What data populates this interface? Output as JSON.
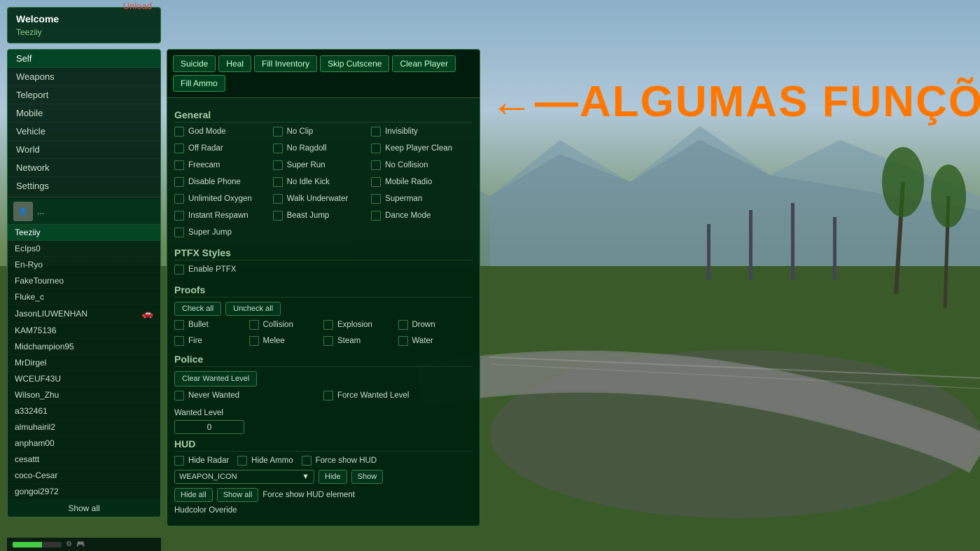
{
  "welcome": {
    "title": "Welcome",
    "username": "Teeziiy",
    "unload_label": "Unload"
  },
  "sidebar": {
    "nav_items": [
      {
        "label": "Self",
        "active": true
      },
      {
        "label": "Weapons",
        "active": false
      },
      {
        "label": "Teleport",
        "active": false
      },
      {
        "label": "Mobile",
        "active": false
      },
      {
        "label": "Vehicle",
        "active": false
      },
      {
        "label": "World",
        "active": false
      },
      {
        "label": "Network",
        "active": false
      },
      {
        "label": "Settings",
        "active": false
      }
    ],
    "users": [
      {
        "name": "Teeziiy",
        "active": true,
        "has_vehicle": false
      },
      {
        "name": "EcIps0",
        "active": false,
        "has_vehicle": false
      },
      {
        "name": "En-Ryo",
        "active": false,
        "has_vehicle": false
      },
      {
        "name": "FakeTourneo",
        "active": false,
        "has_vehicle": false
      },
      {
        "name": "Fluke_c",
        "active": false,
        "has_vehicle": false
      },
      {
        "name": "JasonLIUWENHAN",
        "active": false,
        "has_vehicle": true
      },
      {
        "name": "KAM75136",
        "active": false,
        "has_vehicle": false
      },
      {
        "name": "Midchampion95",
        "active": false,
        "has_vehicle": false
      },
      {
        "name": "MrDirgel",
        "active": false,
        "has_vehicle": false
      },
      {
        "name": "WCEUF43U",
        "active": false,
        "has_vehicle": false
      },
      {
        "name": "Wilson_Zhu",
        "active": false,
        "has_vehicle": false
      },
      {
        "name": "a332461",
        "active": false,
        "has_vehicle": false
      },
      {
        "name": "almuhairil2",
        "active": false,
        "has_vehicle": false
      },
      {
        "name": "anpham00",
        "active": false,
        "has_vehicle": false
      },
      {
        "name": "cesattt",
        "active": false,
        "has_vehicle": false
      },
      {
        "name": "coco-Cesar",
        "active": false,
        "has_vehicle": false
      },
      {
        "name": "gongoi2972",
        "active": false,
        "has_vehicle": false
      }
    ],
    "show_all_label": "Show all"
  },
  "top_buttons": [
    {
      "label": "Suicide",
      "key": "suicide"
    },
    {
      "label": "Heal",
      "key": "heal"
    },
    {
      "label": "Fill Inventory",
      "key": "fill_inventory"
    },
    {
      "label": "Skip Cutscene",
      "key": "skip_cutscene"
    },
    {
      "label": "Clean Player",
      "key": "clean_player"
    },
    {
      "label": "Fill Ammo",
      "key": "fill_ammo"
    }
  ],
  "general": {
    "title": "General",
    "toggles": [
      {
        "label": "God Mode",
        "checked": false
      },
      {
        "label": "No Clip",
        "checked": false
      },
      {
        "label": "Invisiblity",
        "checked": false
      },
      {
        "label": "Off Radar",
        "checked": false
      },
      {
        "label": "No Ragdoll",
        "checked": false
      },
      {
        "label": "Keep Player Clean",
        "checked": false
      },
      {
        "label": "Freecam",
        "checked": false
      },
      {
        "label": "Super Run",
        "checked": false
      },
      {
        "label": "No Collision",
        "checked": false
      },
      {
        "label": "Disable Phone",
        "checked": false
      },
      {
        "label": "No Idle Kick",
        "checked": false
      },
      {
        "label": "Mobile Radio",
        "checked": false
      },
      {
        "label": "Unlimited Oxygen",
        "checked": false
      },
      {
        "label": "Walk Underwater",
        "checked": false
      },
      {
        "label": "Superman",
        "checked": false
      },
      {
        "label": "Instant Respawn",
        "checked": false
      },
      {
        "label": "Beast Jump",
        "checked": false
      },
      {
        "label": "Dance Mode",
        "checked": false
      },
      {
        "label": "Super Jump",
        "checked": false
      }
    ]
  },
  "ptfx": {
    "title": "PTFX Styles",
    "toggles": [
      {
        "label": "Enable PTFX",
        "checked": false
      }
    ]
  },
  "proofs": {
    "title": "Proofs",
    "check_all_label": "Check all",
    "uncheck_all_label": "Uncheck all",
    "items": [
      {
        "label": "Bullet",
        "checked": false
      },
      {
        "label": "Collision",
        "checked": false
      },
      {
        "label": "Explosion",
        "checked": false
      },
      {
        "label": "Drown",
        "checked": false
      },
      {
        "label": "Fire",
        "checked": false
      },
      {
        "label": "Melee",
        "checked": false
      },
      {
        "label": "Steam",
        "checked": false
      },
      {
        "label": "Water",
        "checked": false
      }
    ]
  },
  "police": {
    "title": "Police",
    "clear_wanted_label": "Clear Wanted Level",
    "toggles": [
      {
        "label": "Never Wanted",
        "checked": false
      },
      {
        "label": "Force Wanted Level",
        "checked": false
      }
    ],
    "wanted_level_label": "Wanted Level",
    "wanted_value": "0"
  },
  "hud": {
    "title": "HUD",
    "toggles": [
      {
        "label": "Hide Radar",
        "checked": false
      },
      {
        "label": "Hide Ammo",
        "checked": false
      },
      {
        "label": "Force show HUD",
        "checked": false
      }
    ],
    "dropdown_value": "WEAPON_ICON",
    "hide_label": "Hide",
    "show_label": "Show",
    "hide_all_label": "Hide all",
    "show_all_label": "Show all",
    "force_show_label": "Force show HUD element",
    "override_label": "Hudcolor Overide"
  },
  "overlay": {
    "text": "←—ALGUMAS FUNÇÕES"
  }
}
